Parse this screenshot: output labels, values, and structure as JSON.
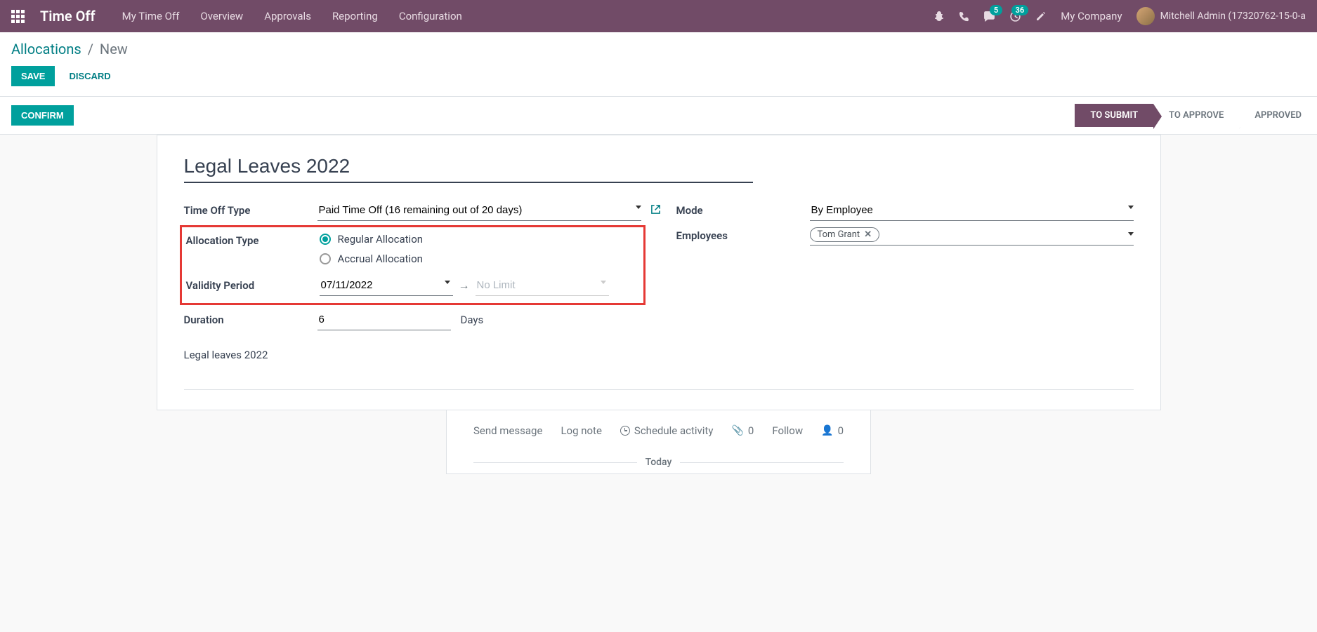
{
  "header": {
    "appTitle": "Time Off",
    "nav": [
      "My Time Off",
      "Overview",
      "Approvals",
      "Reporting",
      "Configuration"
    ],
    "msgBadge": "5",
    "activityBadge": "36",
    "company": "My Company",
    "userName": "Mitchell Admin (17320762-15-0-a"
  },
  "breadcrumb": {
    "parent": "Allocations",
    "current": "New"
  },
  "buttons": {
    "save": "SAVE",
    "discard": "DISCARD",
    "confirm": "CONFIRM"
  },
  "status": {
    "steps": [
      "TO SUBMIT",
      "TO APPROVE",
      "APPROVED"
    ],
    "activeIndex": 0
  },
  "form": {
    "title": "Legal Leaves 2022",
    "labels": {
      "timeOffType": "Time Off Type",
      "allocationType": "Allocation Type",
      "validityPeriod": "Validity Period",
      "duration": "Duration",
      "mode": "Mode",
      "employees": "Employees"
    },
    "timeOffType": "Paid Time Off (16 remaining out of 20 days)",
    "allocationOptions": {
      "regular": "Regular Allocation",
      "accrual": "Accrual Allocation"
    },
    "validityStart": "07/11/2022",
    "validityEndPlaceholder": "No Limit",
    "duration": "6",
    "durationUnit": "Days",
    "description": "Legal leaves 2022",
    "mode": "By Employee",
    "employeeTag": "Tom Grant"
  },
  "chatter": {
    "sendMessage": "Send message",
    "logNote": "Log note",
    "scheduleActivity": "Schedule activity",
    "attachCount": "0",
    "follow": "Follow",
    "followerCount": "0",
    "today": "Today"
  }
}
